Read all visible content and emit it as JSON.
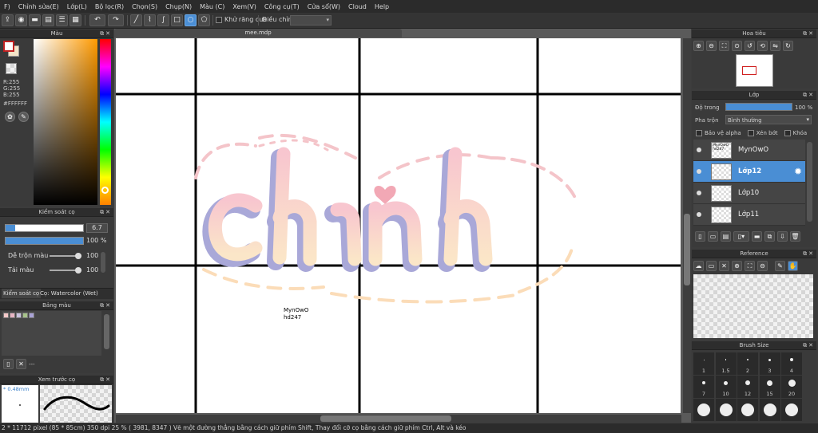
{
  "menu": [
    "F)",
    "Chỉnh sửa(E)",
    "Lớp(L)",
    "Bộ lọc(R)",
    "Chọn(S)",
    "Chụp(N)",
    "Màu (C)",
    "Xem(V)",
    "Công cụ(T)",
    "Cửa sổ(W)",
    "Cloud",
    "Help"
  ],
  "toolbar": {
    "antialias_label": "Khử răng cưa",
    "adjust_label": "Điều chỉnh",
    "adjust_value": ""
  },
  "document": {
    "tab_title": "mee.mdp"
  },
  "canvas": {
    "signature_line1": "MynOwO",
    "signature_line2": "hd247"
  },
  "color_panel": {
    "title": "Màu",
    "r": "R:255",
    "g": "G:255",
    "b": "B:255",
    "hex": "#FFFFFF",
    "primary_color": "#ffffff",
    "secondary_color": "#f3e3c7"
  },
  "brush_control": {
    "title": "Kiểm soát cọ",
    "size_value": "6.7",
    "opacity_value": "100 %",
    "blend_label": "Dễ trộn màu",
    "blend_value": "100",
    "load_label": "Tải màu",
    "load_value": "100",
    "tab_label": "Kiểm soát cọ",
    "brush_name": "Cọ: Watercolor (Wet)"
  },
  "swatches": {
    "title": "Bảng màu",
    "colors": [
      "#f5c9c9",
      "#e7b5c4",
      "#c9c2de",
      "#a7c38a",
      "#a9a2d6"
    ],
    "footer_text": "---"
  },
  "preview": {
    "title": "Xem trước cọ",
    "size_label": "* 0.48mm"
  },
  "navigator": {
    "title": "Hoa tiêu"
  },
  "layers_panel": {
    "title": "Lớp",
    "opacity_label": "Độ trong",
    "opacity_value": "100 %",
    "blend_label": "Pha trộn",
    "blend_value": "Bình thường",
    "protect_alpha": "Bảo vệ alpha",
    "clip": "Xén bớt",
    "lock": "Khóa",
    "layers": [
      {
        "name": "MynOwO",
        "thumb_text": "MynOwO hd247",
        "selected": false
      },
      {
        "name": "Lớp12",
        "thumb_text": "",
        "selected": true
      },
      {
        "name": "Lớp10",
        "thumb_text": "",
        "selected": false
      },
      {
        "name": "Lớp11",
        "thumb_text": "",
        "selected": false
      }
    ]
  },
  "reference": {
    "title": "Reference"
  },
  "brush_size": {
    "title": "Brush Size",
    "sizes": [
      "1",
      "1.5",
      "2",
      "3",
      "4",
      "7",
      "10",
      "12",
      "15",
      "20",
      "",
      "",
      "",
      "",
      ""
    ]
  },
  "status": {
    "text": "2 * 11712 pixel  (85 * 85cm)  350 dpi  25 %  ( 3981, 8347 )  Vẽ một đường thẳng bằng cách giữ phím Shift, Thay đổi cỡ cọ bằng cách giữ phím Ctrl, Alt và kéo"
  },
  "accent_color": "#4a8ed4"
}
